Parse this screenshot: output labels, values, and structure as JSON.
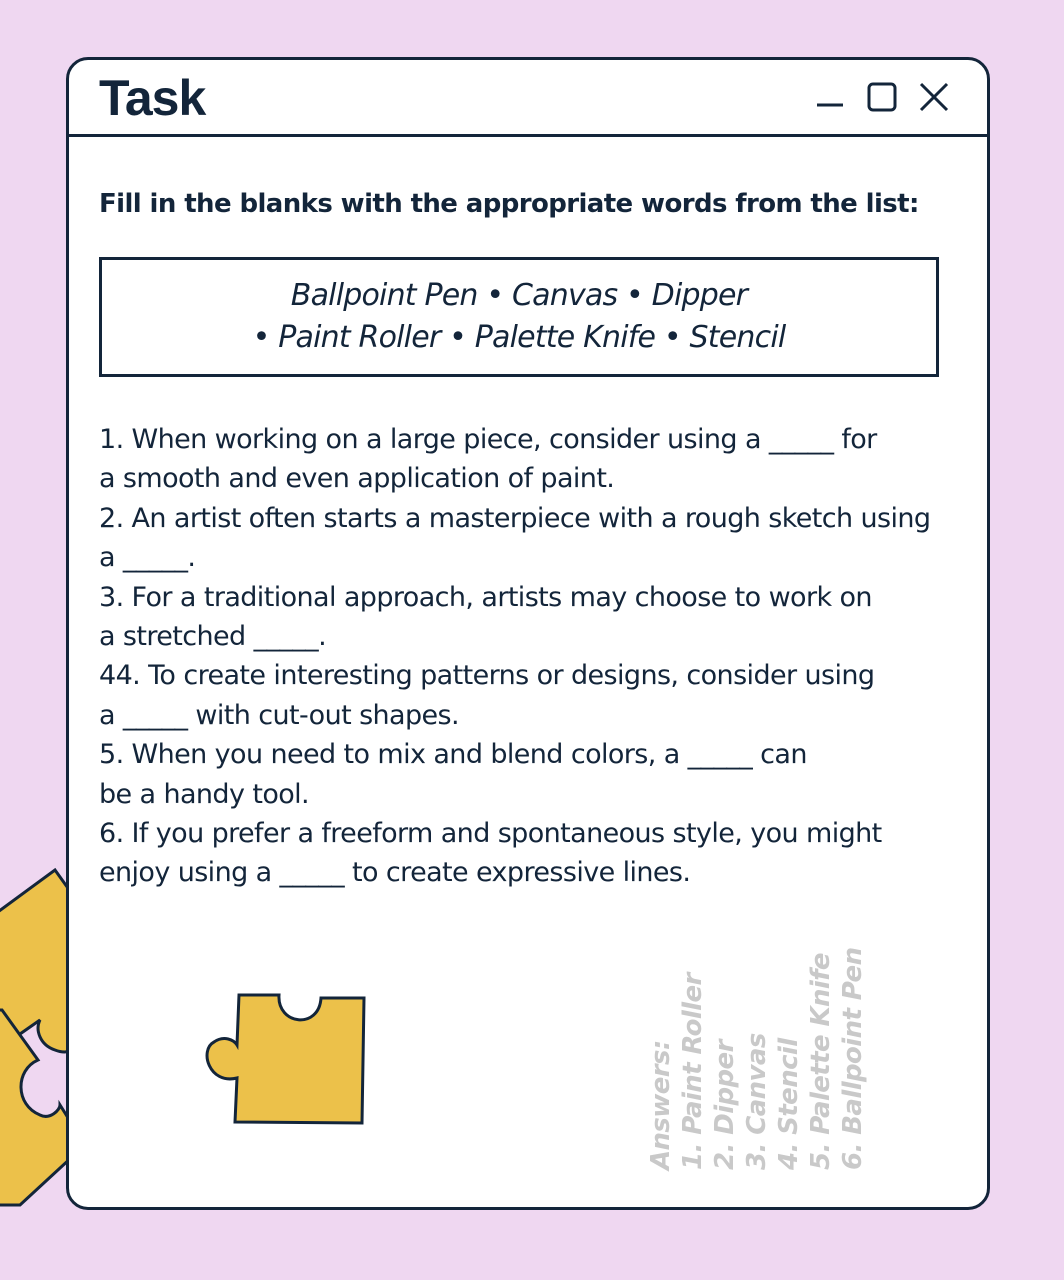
{
  "window": {
    "title": "Task",
    "controls": [
      "minimize-icon",
      "maximize-icon",
      "close-icon"
    ]
  },
  "task": {
    "instruction": "Fill in the blanks with the appropriate words from the list:",
    "word_list": {
      "line1": "Ballpoint Pen • Canvas • Dipper",
      "line2": "• Paint Roller • Palette Knife • Stencil"
    },
    "questions": [
      "1. When working on a large piece, consider using a _____ for",
      "a smooth and even application of paint.",
      "2. An artist often starts a masterpiece with a rough sketch using",
      "a _____.",
      "3. For a traditional approach, artists may choose to work on",
      "a stretched _____.",
      "44. To create interesting patterns or designs, consider using",
      "a _____ with cut-out shapes.",
      "5. When you need to mix and blend colors, a _____ can",
      "be a handy tool.",
      "6. If you prefer a freeform and spontaneous style, you might",
      "enjoy using a _____ to create expressive lines."
    ],
    "answers": [
      "Answers:",
      "1. Paint Roller",
      "2. Dipper",
      "3. Canvas",
      "4. Stencil",
      "5. Palette Knife",
      "6. Ballpoint Pen"
    ]
  },
  "colors": {
    "background": "#efd7f1",
    "window": "#ffffff",
    "ink": "#13253a",
    "puzzle": "#ecc14a",
    "answers_text": "#c9c9c9"
  }
}
